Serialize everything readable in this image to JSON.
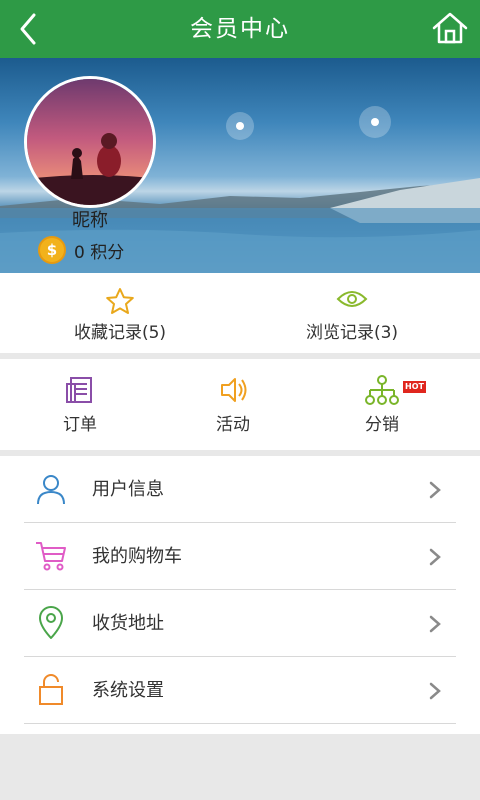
{
  "header": {
    "title": "会员中心",
    "back_icon": "back-arrow-icon",
    "home_icon": "home-icon"
  },
  "profile": {
    "nickname": "昵称",
    "points_label": "0 积分",
    "coin_icon": "coin-icon",
    "coin_symbol": "$"
  },
  "records": [
    {
      "label": "收藏记录(5)",
      "icon": "star-icon"
    },
    {
      "label": "浏览记录(3)",
      "icon": "eye-icon"
    }
  ],
  "quick_links": [
    {
      "label": "订单",
      "icon": "order-icon"
    },
    {
      "label": "活动",
      "icon": "speaker-icon"
    },
    {
      "label": "分销",
      "icon": "distribution-icon",
      "badge": "HOT"
    }
  ],
  "menu": [
    {
      "label": "用户信息",
      "icon": "user-icon"
    },
    {
      "label": "我的购物车",
      "icon": "cart-icon"
    },
    {
      "label": "收货地址",
      "icon": "location-pin-icon"
    },
    {
      "label": "系统设置",
      "icon": "lock-icon"
    }
  ],
  "colors": {
    "brand_green": "#2e9a46",
    "star_yellow": "#e9a81c",
    "eye_green": "#8ab92d",
    "order_purple": "#8a4ea8",
    "speaker_orange": "#f0a020",
    "distribution_green": "#7ab52a",
    "hot_red": "#e0261e",
    "user_blue": "#3a87c8",
    "cart_pink": "#e05cc6",
    "pin_green": "#4aa54a",
    "lock_orange": "#f08a2a"
  }
}
